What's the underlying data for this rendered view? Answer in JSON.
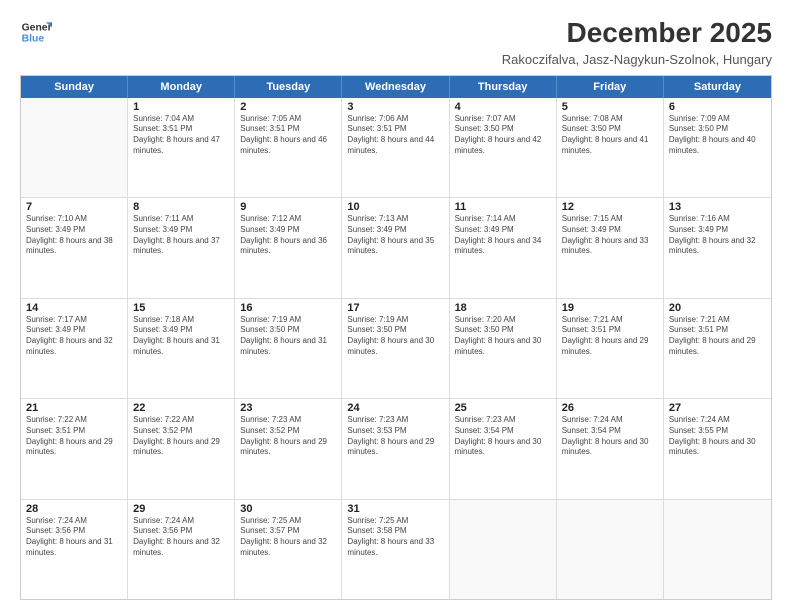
{
  "logo": {
    "line1": "General",
    "line2": "Blue"
  },
  "title": "December 2025",
  "subtitle": "Rakoczifalva, Jasz-Nagykun-Szolnok, Hungary",
  "headers": [
    "Sunday",
    "Monday",
    "Tuesday",
    "Wednesday",
    "Thursday",
    "Friday",
    "Saturday"
  ],
  "weeks": [
    [
      {
        "day": "",
        "sunrise": "",
        "sunset": "",
        "daylight": ""
      },
      {
        "day": "1",
        "sunrise": "Sunrise: 7:04 AM",
        "sunset": "Sunset: 3:51 PM",
        "daylight": "Daylight: 8 hours and 47 minutes."
      },
      {
        "day": "2",
        "sunrise": "Sunrise: 7:05 AM",
        "sunset": "Sunset: 3:51 PM",
        "daylight": "Daylight: 8 hours and 46 minutes."
      },
      {
        "day": "3",
        "sunrise": "Sunrise: 7:06 AM",
        "sunset": "Sunset: 3:51 PM",
        "daylight": "Daylight: 8 hours and 44 minutes."
      },
      {
        "day": "4",
        "sunrise": "Sunrise: 7:07 AM",
        "sunset": "Sunset: 3:50 PM",
        "daylight": "Daylight: 8 hours and 42 minutes."
      },
      {
        "day": "5",
        "sunrise": "Sunrise: 7:08 AM",
        "sunset": "Sunset: 3:50 PM",
        "daylight": "Daylight: 8 hours and 41 minutes."
      },
      {
        "day": "6",
        "sunrise": "Sunrise: 7:09 AM",
        "sunset": "Sunset: 3:50 PM",
        "daylight": "Daylight: 8 hours and 40 minutes."
      }
    ],
    [
      {
        "day": "7",
        "sunrise": "Sunrise: 7:10 AM",
        "sunset": "Sunset: 3:49 PM",
        "daylight": "Daylight: 8 hours and 38 minutes."
      },
      {
        "day": "8",
        "sunrise": "Sunrise: 7:11 AM",
        "sunset": "Sunset: 3:49 PM",
        "daylight": "Daylight: 8 hours and 37 minutes."
      },
      {
        "day": "9",
        "sunrise": "Sunrise: 7:12 AM",
        "sunset": "Sunset: 3:49 PM",
        "daylight": "Daylight: 8 hours and 36 minutes."
      },
      {
        "day": "10",
        "sunrise": "Sunrise: 7:13 AM",
        "sunset": "Sunset: 3:49 PM",
        "daylight": "Daylight: 8 hours and 35 minutes."
      },
      {
        "day": "11",
        "sunrise": "Sunrise: 7:14 AM",
        "sunset": "Sunset: 3:49 PM",
        "daylight": "Daylight: 8 hours and 34 minutes."
      },
      {
        "day": "12",
        "sunrise": "Sunrise: 7:15 AM",
        "sunset": "Sunset: 3:49 PM",
        "daylight": "Daylight: 8 hours and 33 minutes."
      },
      {
        "day": "13",
        "sunrise": "Sunrise: 7:16 AM",
        "sunset": "Sunset: 3:49 PM",
        "daylight": "Daylight: 8 hours and 32 minutes."
      }
    ],
    [
      {
        "day": "14",
        "sunrise": "Sunrise: 7:17 AM",
        "sunset": "Sunset: 3:49 PM",
        "daylight": "Daylight: 8 hours and 32 minutes."
      },
      {
        "day": "15",
        "sunrise": "Sunrise: 7:18 AM",
        "sunset": "Sunset: 3:49 PM",
        "daylight": "Daylight: 8 hours and 31 minutes."
      },
      {
        "day": "16",
        "sunrise": "Sunrise: 7:19 AM",
        "sunset": "Sunset: 3:50 PM",
        "daylight": "Daylight: 8 hours and 31 minutes."
      },
      {
        "day": "17",
        "sunrise": "Sunrise: 7:19 AM",
        "sunset": "Sunset: 3:50 PM",
        "daylight": "Daylight: 8 hours and 30 minutes."
      },
      {
        "day": "18",
        "sunrise": "Sunrise: 7:20 AM",
        "sunset": "Sunset: 3:50 PM",
        "daylight": "Daylight: 8 hours and 30 minutes."
      },
      {
        "day": "19",
        "sunrise": "Sunrise: 7:21 AM",
        "sunset": "Sunset: 3:51 PM",
        "daylight": "Daylight: 8 hours and 29 minutes."
      },
      {
        "day": "20",
        "sunrise": "Sunrise: 7:21 AM",
        "sunset": "Sunset: 3:51 PM",
        "daylight": "Daylight: 8 hours and 29 minutes."
      }
    ],
    [
      {
        "day": "21",
        "sunrise": "Sunrise: 7:22 AM",
        "sunset": "Sunset: 3:51 PM",
        "daylight": "Daylight: 8 hours and 29 minutes."
      },
      {
        "day": "22",
        "sunrise": "Sunrise: 7:22 AM",
        "sunset": "Sunset: 3:52 PM",
        "daylight": "Daylight: 8 hours and 29 minutes."
      },
      {
        "day": "23",
        "sunrise": "Sunrise: 7:23 AM",
        "sunset": "Sunset: 3:52 PM",
        "daylight": "Daylight: 8 hours and 29 minutes."
      },
      {
        "day": "24",
        "sunrise": "Sunrise: 7:23 AM",
        "sunset": "Sunset: 3:53 PM",
        "daylight": "Daylight: 8 hours and 29 minutes."
      },
      {
        "day": "25",
        "sunrise": "Sunrise: 7:23 AM",
        "sunset": "Sunset: 3:54 PM",
        "daylight": "Daylight: 8 hours and 30 minutes."
      },
      {
        "day": "26",
        "sunrise": "Sunrise: 7:24 AM",
        "sunset": "Sunset: 3:54 PM",
        "daylight": "Daylight: 8 hours and 30 minutes."
      },
      {
        "day": "27",
        "sunrise": "Sunrise: 7:24 AM",
        "sunset": "Sunset: 3:55 PM",
        "daylight": "Daylight: 8 hours and 30 minutes."
      }
    ],
    [
      {
        "day": "28",
        "sunrise": "Sunrise: 7:24 AM",
        "sunset": "Sunset: 3:56 PM",
        "daylight": "Daylight: 8 hours and 31 minutes."
      },
      {
        "day": "29",
        "sunrise": "Sunrise: 7:24 AM",
        "sunset": "Sunset: 3:56 PM",
        "daylight": "Daylight: 8 hours and 32 minutes."
      },
      {
        "day": "30",
        "sunrise": "Sunrise: 7:25 AM",
        "sunset": "Sunset: 3:57 PM",
        "daylight": "Daylight: 8 hours and 32 minutes."
      },
      {
        "day": "31",
        "sunrise": "Sunrise: 7:25 AM",
        "sunset": "Sunset: 3:58 PM",
        "daylight": "Daylight: 8 hours and 33 minutes."
      },
      {
        "day": "",
        "sunrise": "",
        "sunset": "",
        "daylight": ""
      },
      {
        "day": "",
        "sunrise": "",
        "sunset": "",
        "daylight": ""
      },
      {
        "day": "",
        "sunrise": "",
        "sunset": "",
        "daylight": ""
      }
    ]
  ]
}
